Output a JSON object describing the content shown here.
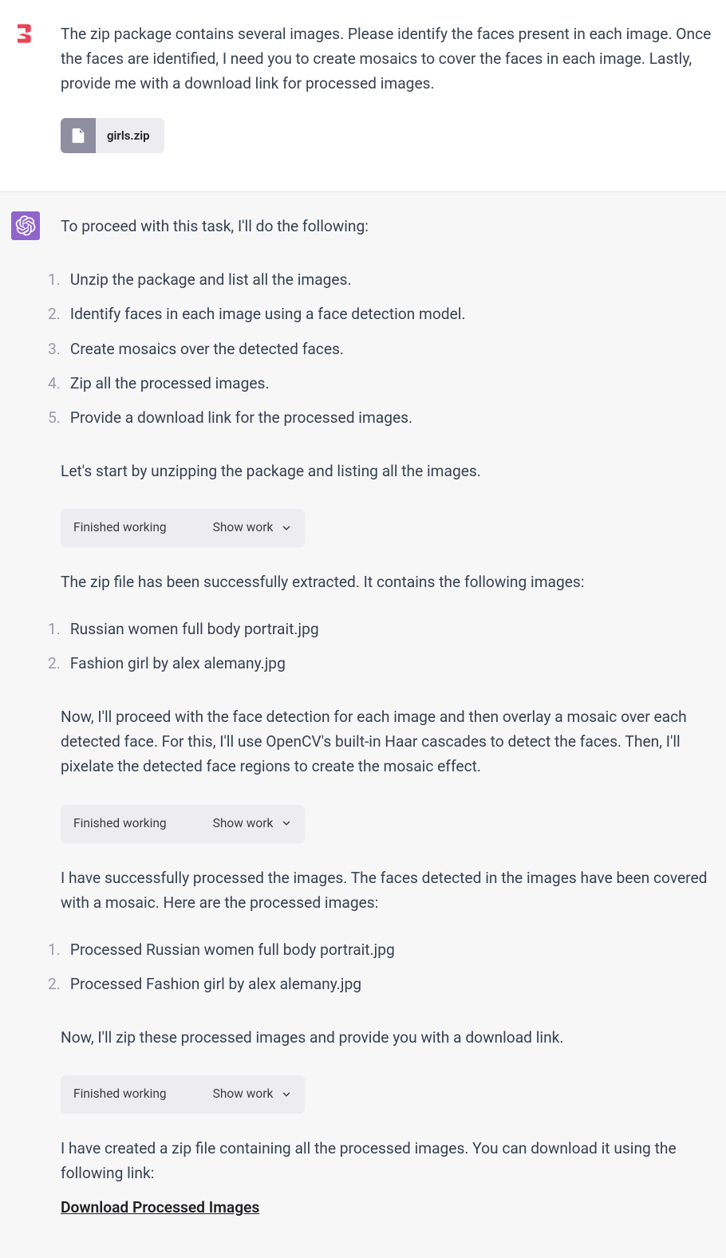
{
  "user": {
    "message": "The zip package contains several images.  Please identify the faces present in each image. Once the faces are identified, I need you to create mosaics to cover the faces in each image. Lastly, provide me with a download link for processed images.",
    "attachment": {
      "name": "girls.zip"
    }
  },
  "assistant": {
    "intro": "To proceed with this task, I'll do the following:",
    "steps": [
      "Unzip the package and list all the images.",
      "Identify faces in each image using a face detection model.",
      "Create mosaics over the detected faces.",
      "Zip all the processed images.",
      "Provide a download link for the processed images."
    ],
    "after_steps_para": "Let's start by unzipping the package and listing all the images.",
    "work1": {
      "status": "Finished working",
      "toggle": "Show work"
    },
    "extracted_para": "The zip file has been successfully extracted. It contains the following images:",
    "files": [
      "Russian women full body portrait.jpg",
      "Fashion girl by alex alemany.jpg"
    ],
    "detect_para": "Now, I'll proceed with the face detection for each image and then overlay a mosaic over each detected face. For this, I'll use OpenCV's built-in Haar cascades to detect the faces. Then, I'll pixelate the detected face regions to create the mosaic effect.",
    "work2": {
      "status": "Finished working",
      "toggle": "Show work"
    },
    "processed_para": "I have successfully processed the images. The faces detected in the images have been covered with a mosaic. Here are the processed images:",
    "processed_files": [
      "Processed Russian women full body portrait.jpg",
      "Processed Fashion girl by alex alemany.jpg"
    ],
    "zip_para": "Now, I'll zip these processed images and provide you with a download link.",
    "work3": {
      "status": "Finished working",
      "toggle": "Show work"
    },
    "download_intro": "I have created a zip file containing all the processed images. You can download it using the following link:",
    "download_link_text": "Download Processed Images"
  }
}
